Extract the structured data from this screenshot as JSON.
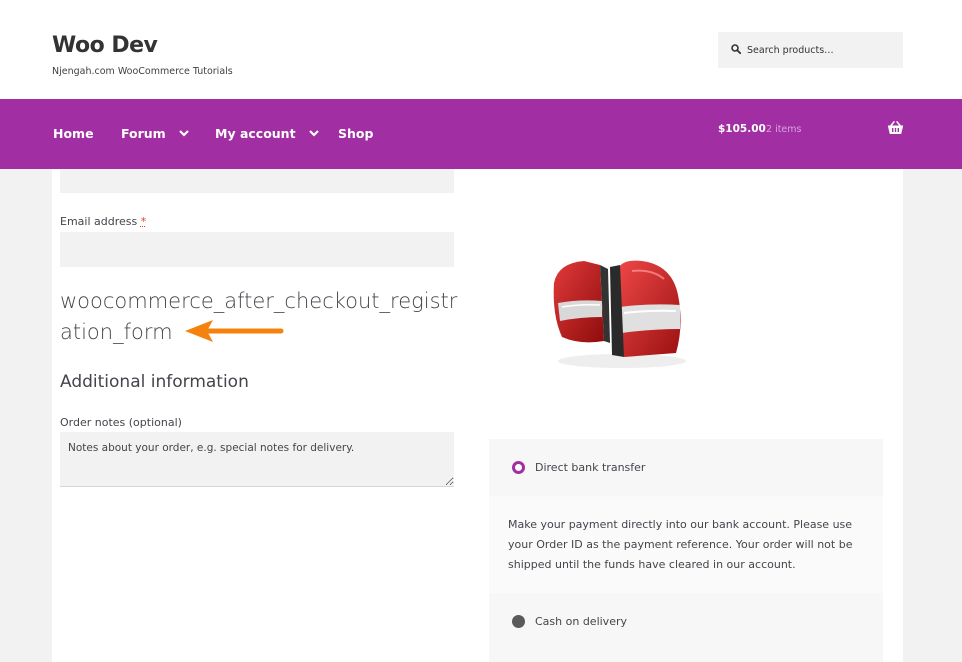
{
  "site": {
    "title": "Woo Dev",
    "tagline": "Njengah.com WooCommerce Tutorials"
  },
  "search": {
    "placeholder": "Search products…",
    "icon": "search-icon"
  },
  "nav": {
    "items": [
      {
        "label": "Home",
        "has_dropdown": false
      },
      {
        "label": "Forum",
        "has_dropdown": true
      },
      {
        "label": "My account",
        "has_dropdown": true
      },
      {
        "label": "Shop",
        "has_dropdown": false
      }
    ],
    "background": "#a12fa3"
  },
  "cart": {
    "amount": "$105.00",
    "count": "2 items",
    "icon": "basket-icon"
  },
  "form": {
    "email_label": "Email address",
    "required_mark": "*",
    "hook_title": "woocommerce_after_checkout_registration_form",
    "additional_title": "Additional information",
    "notes_label": "Order notes (optional)",
    "notes_placeholder": "Notes about your order, e.g. special notes for delivery."
  },
  "payment": {
    "methods": [
      {
        "label": "Direct bank transfer",
        "selected": true
      },
      {
        "label": "Cash on delivery",
        "selected": false
      }
    ],
    "bank_description": "Make your payment directly into our bank account. Please use your Order ID as the payment reference. Your order will not be shipped until the funds have cleared in our account."
  },
  "colors": {
    "accent": "#a12fa3",
    "annotation_arrow": "#f5820d"
  }
}
